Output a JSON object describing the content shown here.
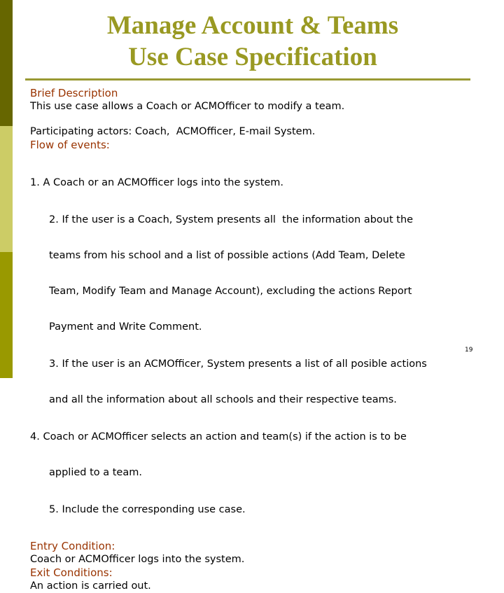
{
  "slide": {
    "title_line1": "Manage Account & Teams",
    "title_line2": "Use Case Specification",
    "page_number": "19",
    "colors": {
      "bar_top": "#666600",
      "bar_middle": "#cccc66",
      "bar_bottom": "#999900",
      "title": "#999922",
      "heading": "#993300"
    }
  },
  "content": {
    "brief_heading": "Brief Description",
    "brief_text": "This use case allows a Coach or ACMOfficer to modify a team.",
    "actors_text": "Participating actors: Coach,  ACMOfficer, E-mail System.",
    "flow_heading": "Flow of events:",
    "flow": {
      "step1": "1. A Coach or an ACMOfficer logs into the system.",
      "step2_lines": [
        "2. If the user is a Coach, System presents all  the information about the",
        "teams from his school and a list of possible actions (Add Team, Delete",
        "Team, Modify Team and Manage Account), excluding the actions Report",
        "Payment and Write Comment."
      ],
      "step3_lines": [
        "3. If the user is an ACMOfficer, System presents a list of all posible actions",
        "and all the information about all schools and their respective teams."
      ],
      "step4_lines": [
        "4. Coach or ACMOfficer selects an action and team(s) if the action is to be",
        "applied to a team."
      ],
      "step5": "5. Include the corresponding use case."
    },
    "entry_heading": "Entry Condition:",
    "entry_text": "Coach or ACMOfficer logs into the system.",
    "exit_heading": "Exit Conditions:",
    "exit_text": "An action is carried out."
  }
}
